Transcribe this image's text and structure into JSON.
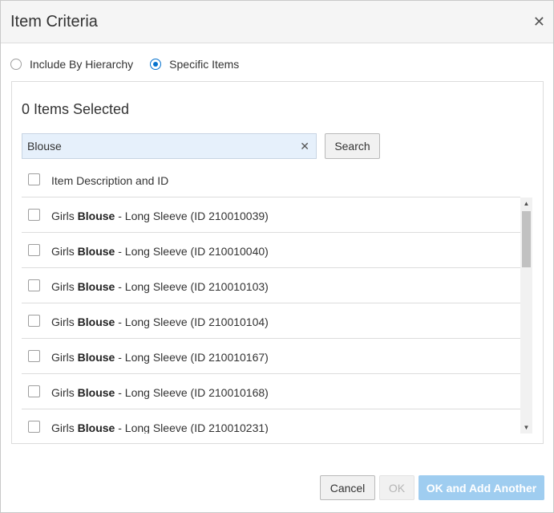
{
  "dialog": {
    "title": "Item Criteria",
    "close_icon": "close-icon"
  },
  "mode": {
    "options": [
      {
        "label": "Include By Hierarchy",
        "selected": false
      },
      {
        "label": "Specific Items",
        "selected": true
      }
    ]
  },
  "panel": {
    "selected_count": "0 Items Selected",
    "search": {
      "value": "Blouse",
      "clear_icon": "clear-icon",
      "button_label": "Search"
    },
    "list_header": "Item Description and ID",
    "items": [
      {
        "prefix": "Girls ",
        "match": "Blouse",
        "suffix": " - Long Sleeve (ID 210010039)"
      },
      {
        "prefix": "Girls ",
        "match": "Blouse",
        "suffix": " - Long Sleeve (ID 210010040)"
      },
      {
        "prefix": "Girls ",
        "match": "Blouse",
        "suffix": " - Long Sleeve (ID 210010103)"
      },
      {
        "prefix": "Girls ",
        "match": "Blouse",
        "suffix": " - Long Sleeve (ID 210010104)"
      },
      {
        "prefix": "Girls ",
        "match": "Blouse",
        "suffix": " - Long Sleeve (ID 210010167)"
      },
      {
        "prefix": "Girls ",
        "match": "Blouse",
        "suffix": " - Long Sleeve (ID 210010168)"
      },
      {
        "prefix": "Girls ",
        "match": "Blouse",
        "suffix": " - Long Sleeve (ID 210010231)"
      }
    ]
  },
  "footer": {
    "cancel_label": "Cancel",
    "ok_label": "OK",
    "ok_add_label": "OK and Add Another"
  },
  "colors": {
    "accent": "#0572ce",
    "primary_button_disabled": "#9fcdf0",
    "search_field_bg": "#e6f0fb"
  }
}
